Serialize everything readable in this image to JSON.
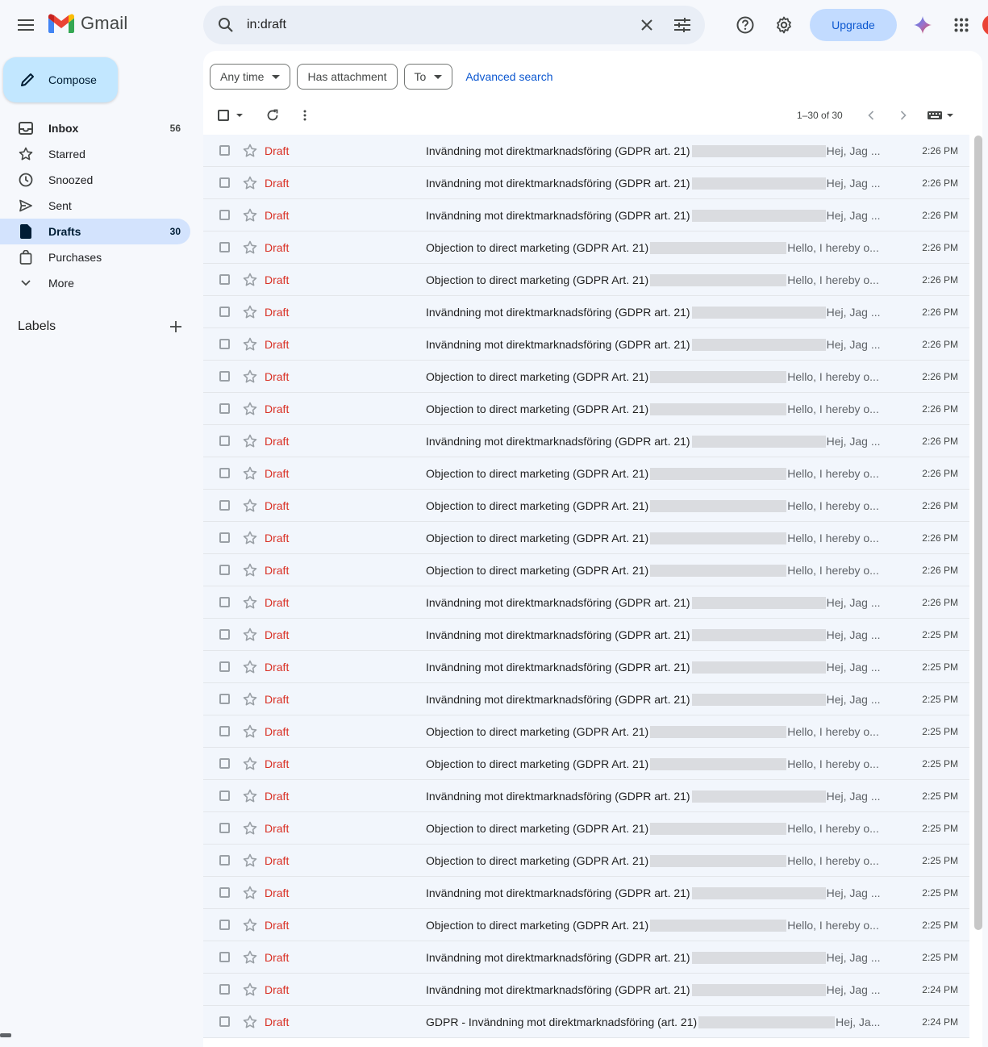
{
  "app": {
    "name": "Gmail"
  },
  "search": {
    "value": "in:draft"
  },
  "header": {
    "upgrade_label": "Upgrade"
  },
  "compose": {
    "label": "Compose"
  },
  "sidebar": {
    "items": [
      {
        "label": "Inbox",
        "count": "56"
      },
      {
        "label": "Starred",
        "count": ""
      },
      {
        "label": "Snoozed",
        "count": ""
      },
      {
        "label": "Sent",
        "count": ""
      },
      {
        "label": "Drafts",
        "count": "30"
      },
      {
        "label": "Purchases",
        "count": ""
      },
      {
        "label": "More",
        "count": ""
      }
    ],
    "labels_heading": "Labels"
  },
  "filters": {
    "any_time": "Any time",
    "has_attachment": "Has attachment",
    "to": "To",
    "advanced_search": "Advanced search"
  },
  "pager": {
    "text": "1–30 of 30"
  },
  "colors": {
    "accent": "#0b57d0",
    "draft": "#d93025",
    "active_nav": "#d3e3fd",
    "compose": "#c2e7ff"
  },
  "messages": [
    {
      "sender": "Draft",
      "subject": "Invändning mot direktmarknadsföring (GDPR art. 21)",
      "snippet": "Hej, Jag ...",
      "time": "2:26 PM"
    },
    {
      "sender": "Draft",
      "subject": "Invändning mot direktmarknadsföring (GDPR art. 21)",
      "snippet": "Hej, Jag ...",
      "time": "2:26 PM"
    },
    {
      "sender": "Draft",
      "subject": "Invändning mot direktmarknadsföring (GDPR art. 21)",
      "snippet": "Hej, Jag ...",
      "time": "2:26 PM"
    },
    {
      "sender": "Draft",
      "subject": "Objection to direct marketing (GDPR Art. 21)",
      "snippet": "Hello, I hereby o...",
      "time": "2:26 PM"
    },
    {
      "sender": "Draft",
      "subject": "Objection to direct marketing (GDPR Art. 21)",
      "snippet": "Hello, I hereby o...",
      "time": "2:26 PM"
    },
    {
      "sender": "Draft",
      "subject": "Invändning mot direktmarknadsföring (GDPR art. 21)",
      "snippet": "Hej, Jag ...",
      "time": "2:26 PM"
    },
    {
      "sender": "Draft",
      "subject": "Invändning mot direktmarknadsföring (GDPR art. 21)",
      "snippet": "Hej, Jag ...",
      "time": "2:26 PM"
    },
    {
      "sender": "Draft",
      "subject": "Objection to direct marketing (GDPR Art. 21)",
      "snippet": "Hello, I hereby o...",
      "time": "2:26 PM"
    },
    {
      "sender": "Draft",
      "subject": "Objection to direct marketing (GDPR Art. 21)",
      "snippet": "Hello, I hereby o...",
      "time": "2:26 PM"
    },
    {
      "sender": "Draft",
      "subject": "Invändning mot direktmarknadsföring (GDPR art. 21)",
      "snippet": "Hej, Jag ...",
      "time": "2:26 PM"
    },
    {
      "sender": "Draft",
      "subject": "Objection to direct marketing (GDPR Art. 21)",
      "snippet": "Hello, I hereby o...",
      "time": "2:26 PM"
    },
    {
      "sender": "Draft",
      "subject": "Objection to direct marketing (GDPR Art. 21)",
      "snippet": "Hello, I hereby o...",
      "time": "2:26 PM"
    },
    {
      "sender": "Draft",
      "subject": "Objection to direct marketing (GDPR Art. 21)",
      "snippet": "Hello, I hereby o...",
      "time": "2:26 PM"
    },
    {
      "sender": "Draft",
      "subject": "Objection to direct marketing (GDPR Art. 21)",
      "snippet": "Hello, I hereby o...",
      "time": "2:26 PM"
    },
    {
      "sender": "Draft",
      "subject": "Invändning mot direktmarknadsföring (GDPR art. 21)",
      "snippet": "Hej, Jag ...",
      "time": "2:26 PM"
    },
    {
      "sender": "Draft",
      "subject": "Invändning mot direktmarknadsföring (GDPR art. 21)",
      "snippet": "Hej, Jag ...",
      "time": "2:25 PM"
    },
    {
      "sender": "Draft",
      "subject": "Invändning mot direktmarknadsföring (GDPR art. 21)",
      "snippet": "Hej, Jag ...",
      "time": "2:25 PM"
    },
    {
      "sender": "Draft",
      "subject": "Invändning mot direktmarknadsföring (GDPR art. 21)",
      "snippet": "Hej, Jag ...",
      "time": "2:25 PM"
    },
    {
      "sender": "Draft",
      "subject": "Objection to direct marketing (GDPR Art. 21)",
      "snippet": "Hello, I hereby o...",
      "time": "2:25 PM"
    },
    {
      "sender": "Draft",
      "subject": "Objection to direct marketing (GDPR Art. 21)",
      "snippet": "Hello, I hereby o...",
      "time": "2:25 PM"
    },
    {
      "sender": "Draft",
      "subject": "Invändning mot direktmarknadsföring (GDPR art. 21)",
      "snippet": "Hej, Jag ...",
      "time": "2:25 PM"
    },
    {
      "sender": "Draft",
      "subject": "Objection to direct marketing (GDPR Art. 21)",
      "snippet": "Hello, I hereby o...",
      "time": "2:25 PM"
    },
    {
      "sender": "Draft",
      "subject": "Objection to direct marketing (GDPR Art. 21)",
      "snippet": "Hello, I hereby o...",
      "time": "2:25 PM"
    },
    {
      "sender": "Draft",
      "subject": "Invändning mot direktmarknadsföring (GDPR art. 21)",
      "snippet": "Hej, Jag ...",
      "time": "2:25 PM"
    },
    {
      "sender": "Draft",
      "subject": "Objection to direct marketing (GDPR Art. 21)",
      "snippet": "Hello, I hereby o...",
      "time": "2:25 PM"
    },
    {
      "sender": "Draft",
      "subject": "Invändning mot direktmarknadsföring (GDPR art. 21)",
      "snippet": "Hej, Jag ...",
      "time": "2:25 PM"
    },
    {
      "sender": "Draft",
      "subject": "Invändning mot direktmarknadsföring (GDPR art. 21)",
      "snippet": "Hej, Jag ...",
      "time": "2:24 PM"
    },
    {
      "sender": "Draft",
      "subject": "GDPR - Invändning mot direktmarknadsföring (art. 21)",
      "snippet": "Hej, Ja...",
      "time": "2:24 PM"
    }
  ]
}
